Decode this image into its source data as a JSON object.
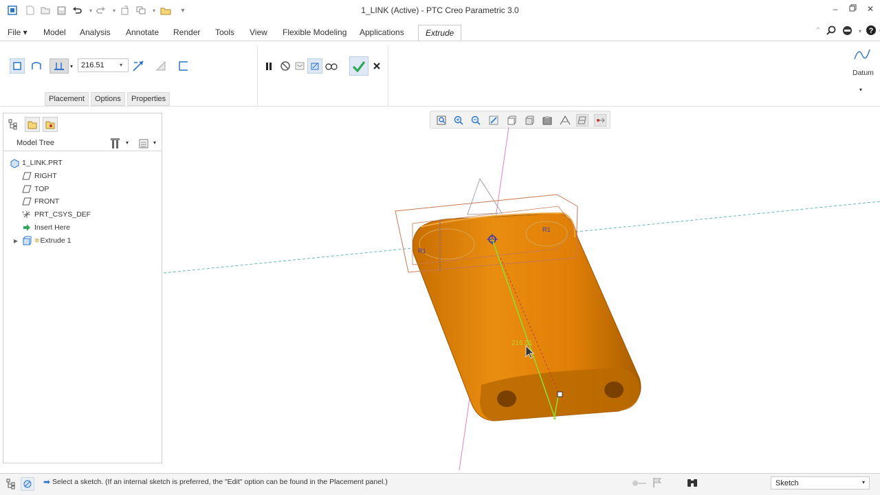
{
  "window": {
    "title": "1_LINK (Active) - PTC Creo Parametric 3.0"
  },
  "menu": {
    "items": [
      "File",
      "Model",
      "Analysis",
      "Annotate",
      "Render",
      "Tools",
      "View",
      "Flexible Modeling",
      "Applications",
      "Extrude"
    ],
    "active": "Extrude"
  },
  "ribbon": {
    "depth_value": "216.51",
    "tabs": [
      "Placement",
      "Options",
      "Properties"
    ],
    "datum_label": "Datum"
  },
  "model_tree": {
    "title": "Model Tree",
    "items": [
      {
        "label": "1_LINK.PRT",
        "icon": "part-icon"
      },
      {
        "label": "RIGHT",
        "icon": "datum-plane-icon"
      },
      {
        "label": "TOP",
        "icon": "datum-plane-icon"
      },
      {
        "label": "FRONT",
        "icon": "datum-plane-icon"
      },
      {
        "label": "PRT_CSYS_DEF",
        "icon": "csys-icon"
      },
      {
        "label": "Insert Here",
        "icon": "insert-arrow-icon"
      },
      {
        "label": "Extrude 1",
        "icon": "extrude-icon"
      }
    ]
  },
  "viewport": {
    "dimension_label": "216.51",
    "sketch_labels": [
      "R1",
      "R1"
    ],
    "part_color": "#e48a0a",
    "part_shadow": "#b86a00"
  },
  "status": {
    "message": "Select a sketch. (If an internal sketch is preferred, the \"Edit\" option can be found in the Placement panel.)",
    "filter_value": "Sketch"
  },
  "colors": {
    "accent_green": "#2fa85a",
    "accent_blue": "#2b72c9"
  }
}
